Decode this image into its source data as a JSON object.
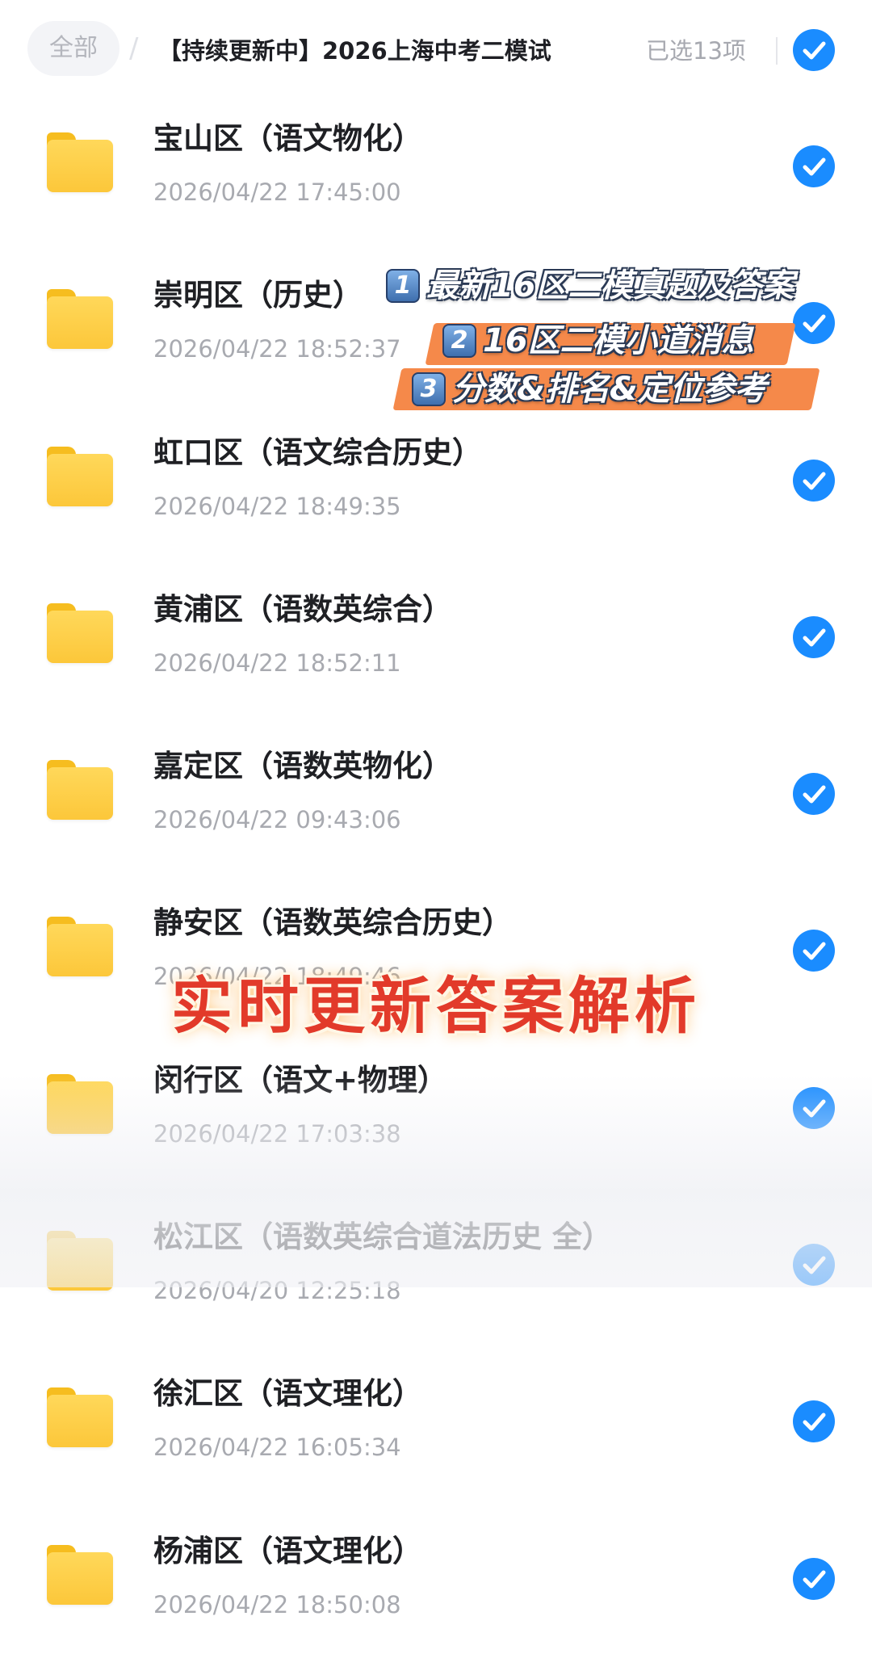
{
  "header": {
    "root_label": "全部",
    "separator": "/",
    "current_folder": "【持续更新中】2026上海中考二模试",
    "selected_count": "已选13项"
  },
  "items": [
    {
      "title": "宝山区（语文物化）",
      "time": "2026/04/22 17:45:00"
    },
    {
      "title": "崇明区（历史）",
      "time": "2026/04/22 18:52:37"
    },
    {
      "title": "虹口区（语文综合历史）",
      "time": "2026/04/22 18:49:35"
    },
    {
      "title": "黄浦区（语数英综合）",
      "time": "2026/04/22 18:52:11"
    },
    {
      "title": "嘉定区（语数英物化）",
      "time": "2026/04/22 09:43:06"
    },
    {
      "title": "静安区（语数英综合历史）",
      "time": "2026/04/22 18:49:46"
    },
    {
      "title": "闵行区（语文+物理）",
      "time": "2026/04/22 17:03:38"
    },
    {
      "title": "松江区（语数英综合道法历史 全）",
      "time": "2026/04/20 12:25:18"
    },
    {
      "title": "徐汇区（语文理化）",
      "time": "2026/04/22 16:05:34"
    },
    {
      "title": "杨浦区（语文理化）",
      "time": "2026/04/22 18:50:08"
    }
  ],
  "promo": {
    "lines": [
      {
        "num": "1",
        "text": "最新16区二模真题及答案"
      },
      {
        "num": "2",
        "text": "16区二模小道消息"
      },
      {
        "num": "3",
        "text": "分数&排名&定位参考"
      }
    ],
    "banner": "实时更新答案解析"
  },
  "colors": {
    "accent": "#1a8cff",
    "folder": "#fcc73a",
    "promo_band": "#f5894a",
    "banner_text": "#e23a2a"
  },
  "icons": {
    "folder": "folder-icon",
    "check": "check-circle-icon"
  }
}
